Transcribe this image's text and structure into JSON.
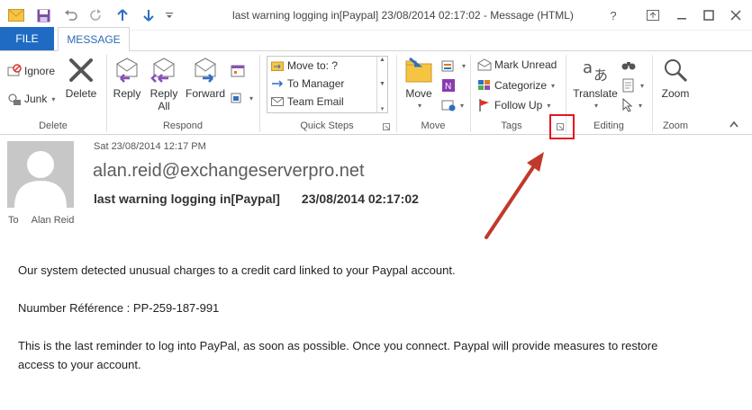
{
  "window": {
    "title": "last warning logging in[Paypal]    23/08/2014 02:17:02 - Message (HTML)",
    "help": "?"
  },
  "tabs": {
    "file": "FILE",
    "message": "MESSAGE"
  },
  "ribbon": {
    "delete_group": {
      "label": "Delete",
      "ignore": "Ignore",
      "junk": "Junk",
      "delete": "Delete"
    },
    "respond_group": {
      "label": "Respond",
      "reply": "Reply",
      "reply_all_1": "Reply",
      "reply_all_2": "All",
      "forward": "Forward"
    },
    "quick_steps_group": {
      "label": "Quick Steps",
      "items": [
        "Move to: ?",
        "To Manager",
        "Team Email"
      ]
    },
    "move_group": {
      "label": "Move",
      "move": "Move"
    },
    "tags_group": {
      "label": "Tags",
      "mark_unread": "Mark Unread",
      "categorize": "Categorize",
      "follow_up": "Follow Up"
    },
    "editing_group": {
      "label": "Editing",
      "translate": "Translate"
    },
    "zoom_group": {
      "label": "Zoom",
      "zoom": "Zoom"
    }
  },
  "message": {
    "sent_date": "Sat 23/08/2014 12:17 PM",
    "sender": "alan.reid@exchangeserverpro.net",
    "subject": "last warning logging in[Paypal]",
    "subject_date": "23/08/2014 02:17:02",
    "to_label": "To",
    "to_name": "Alan Reid"
  },
  "body": {
    "p1": "Our system detected unusual charges to a credit card linked to your Paypal account.",
    "p2": "Nuumber Référence : PP-259-187-991",
    "p3_line1": "This is the last reminder to log into PayPal, as soon as possible. Once you connect. Paypal will provide measures to restore",
    "p3_line2": "access to your account."
  },
  "colors": {
    "accent": "#1f6bc4",
    "highlight": "#e8141e",
    "arrow": "#c0392b"
  }
}
